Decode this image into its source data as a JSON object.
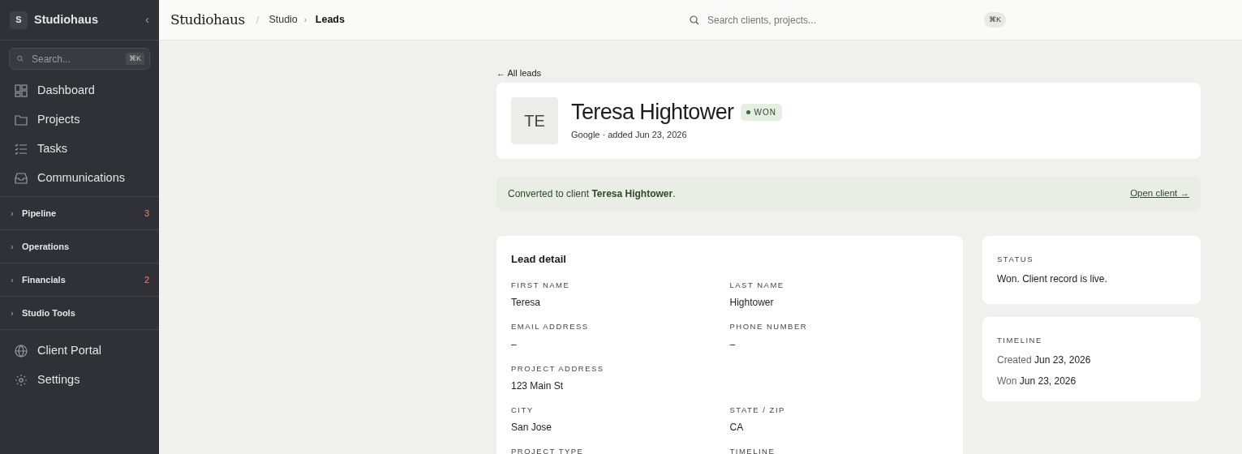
{
  "sidebar": {
    "logo_letter": "S",
    "brand": "Studiohaus",
    "collapse": "‹",
    "search": {
      "placeholder": "Search...",
      "shortcut": "⌘K"
    },
    "nav": [
      {
        "label": "Dashboard"
      },
      {
        "label": "Projects"
      },
      {
        "label": "Tasks"
      },
      {
        "label": "Communications"
      }
    ],
    "sections": [
      {
        "chevron": "›",
        "label": "Pipeline",
        "count": "3"
      },
      {
        "chevron": "›",
        "label": "Operations"
      },
      {
        "chevron": "›",
        "label": "Financials",
        "count": "2"
      },
      {
        "chevron": "›",
        "label": "Studio Tools"
      }
    ],
    "footer_nav": [
      {
        "label": "Client Portal"
      },
      {
        "label": "Settings"
      }
    ]
  },
  "header": {
    "title": "Studiohaus",
    "separator": "/",
    "breadcrumb": [
      {
        "label": "Studio",
        "current": false
      },
      {
        "chevron": "›",
        "label": "Leads",
        "current": true
      }
    ],
    "search": {
      "placeholder": "Search clients, projects...",
      "shortcut": "⌘K"
    }
  },
  "back_link": "← All leads",
  "lead": {
    "initials": "TE",
    "name": "Teresa Hightower",
    "status": "WON",
    "subtitle": "Google · added Jun 23, 2026"
  },
  "banner": {
    "text": "Converted to client **Teresa Hightower**.",
    "link": "Open client →"
  },
  "detail": {
    "title": "Lead detail",
    "fields": [
      {
        "label": "FIRST NAME",
        "value": "Teresa"
      },
      {
        "label": "LAST NAME",
        "value": "Hightower"
      },
      {
        "label": "EMAIL ADDRESS",
        "value": "–"
      },
      {
        "label": "PHONE NUMBER",
        "value": "–"
      },
      {
        "label": "PROJECT ADDRESS",
        "value": "123 Main St",
        "wide": true
      },
      {
        "label": "CITY",
        "value": "San Jose"
      },
      {
        "label": "STATE / ZIP",
        "value": "CA"
      },
      {
        "label": "PROJECT TYPE"
      },
      {
        "label": "TIMELINE"
      }
    ]
  },
  "status_card": {
    "title": "STATUS",
    "text": "Won. Client record is live."
  },
  "timeline_card": {
    "title": "TIMELINE",
    "events": [
      {
        "label": "Created",
        "date": "Jun 23, 2026"
      },
      {
        "label": "Won",
        "date": "Jun 23, 2026"
      }
    ]
  }
}
